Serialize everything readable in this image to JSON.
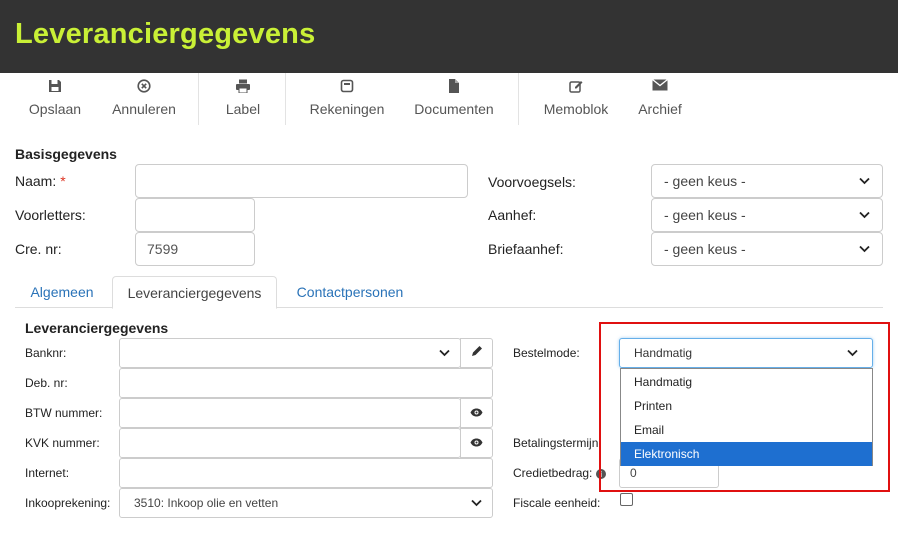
{
  "title": "Leveranciergegevens",
  "toolbar": {
    "items": [
      {
        "label": "Opslaan",
        "icon": "save-icon"
      },
      {
        "label": "Annuleren",
        "icon": "cancel-circle-icon"
      },
      {
        "label": "Label",
        "icon": "print-icon"
      },
      {
        "label": "Rekeningen",
        "icon": "invoice-icon"
      },
      {
        "label": "Documenten",
        "icon": "document-icon"
      },
      {
        "label": "Memoblok",
        "icon": "edit-icon"
      },
      {
        "label": "Archief",
        "icon": "envelope-icon"
      }
    ]
  },
  "basis": {
    "heading": "Basisgegevens",
    "naam_label": "Naam:",
    "required_mark": "*",
    "naam_value": "",
    "voorletters_label": "Voorletters:",
    "voorletters_value": "",
    "crenr_label": "Cre. nr:",
    "crenr_value": "7599",
    "voorvoegsels_label": "Voorvoegsels:",
    "voorvoegsels_value": "- geen keus -",
    "aanhef_label": "Aanhef:",
    "aanhef_value": "- geen keus -",
    "briefaanhef_label": "Briefaanhef:",
    "briefaanhef_value": "- geen keus -"
  },
  "tabs": [
    {
      "label": "Algemeen",
      "active": false
    },
    {
      "label": "Leveranciergegevens",
      "active": true
    },
    {
      "label": "Contactpersonen",
      "active": false
    }
  ],
  "leverancier": {
    "heading": "Leveranciergegevens",
    "banknr_label": "Banknr:",
    "banknr_value": "",
    "debnr_label": "Deb. nr:",
    "debnr_value": "",
    "btw_label": "BTW nummer:",
    "btw_value": "",
    "kvk_label": "KVK nummer:",
    "kvk_value": "",
    "internet_label": "Internet:",
    "internet_value": "",
    "inkoop_label": "Inkooprekening:",
    "inkoop_value": "3510: Inkoop olie en vetten",
    "bestelmode_label": "Bestelmode:",
    "bestelmode_value": "Handmatig",
    "bestelmode_options": [
      "Handmatig",
      "Printen",
      "Email",
      "Elektronisch"
    ],
    "bestelmode_highlighted": "Elektronisch",
    "betalingstermijn_label": "Betalingstermijn",
    "kredietbedrag_label": "Credietbedrag:",
    "kredietbedrag_value": "0",
    "fiscale_label": "Fiscale eenheid:",
    "fiscale_checked": false
  },
  "colors": {
    "title_bg": "#333333",
    "title_text": "#c9f036",
    "link": "#2a73b8",
    "selected_option": "#1e6fd0",
    "highlight_border": "#e01010"
  }
}
